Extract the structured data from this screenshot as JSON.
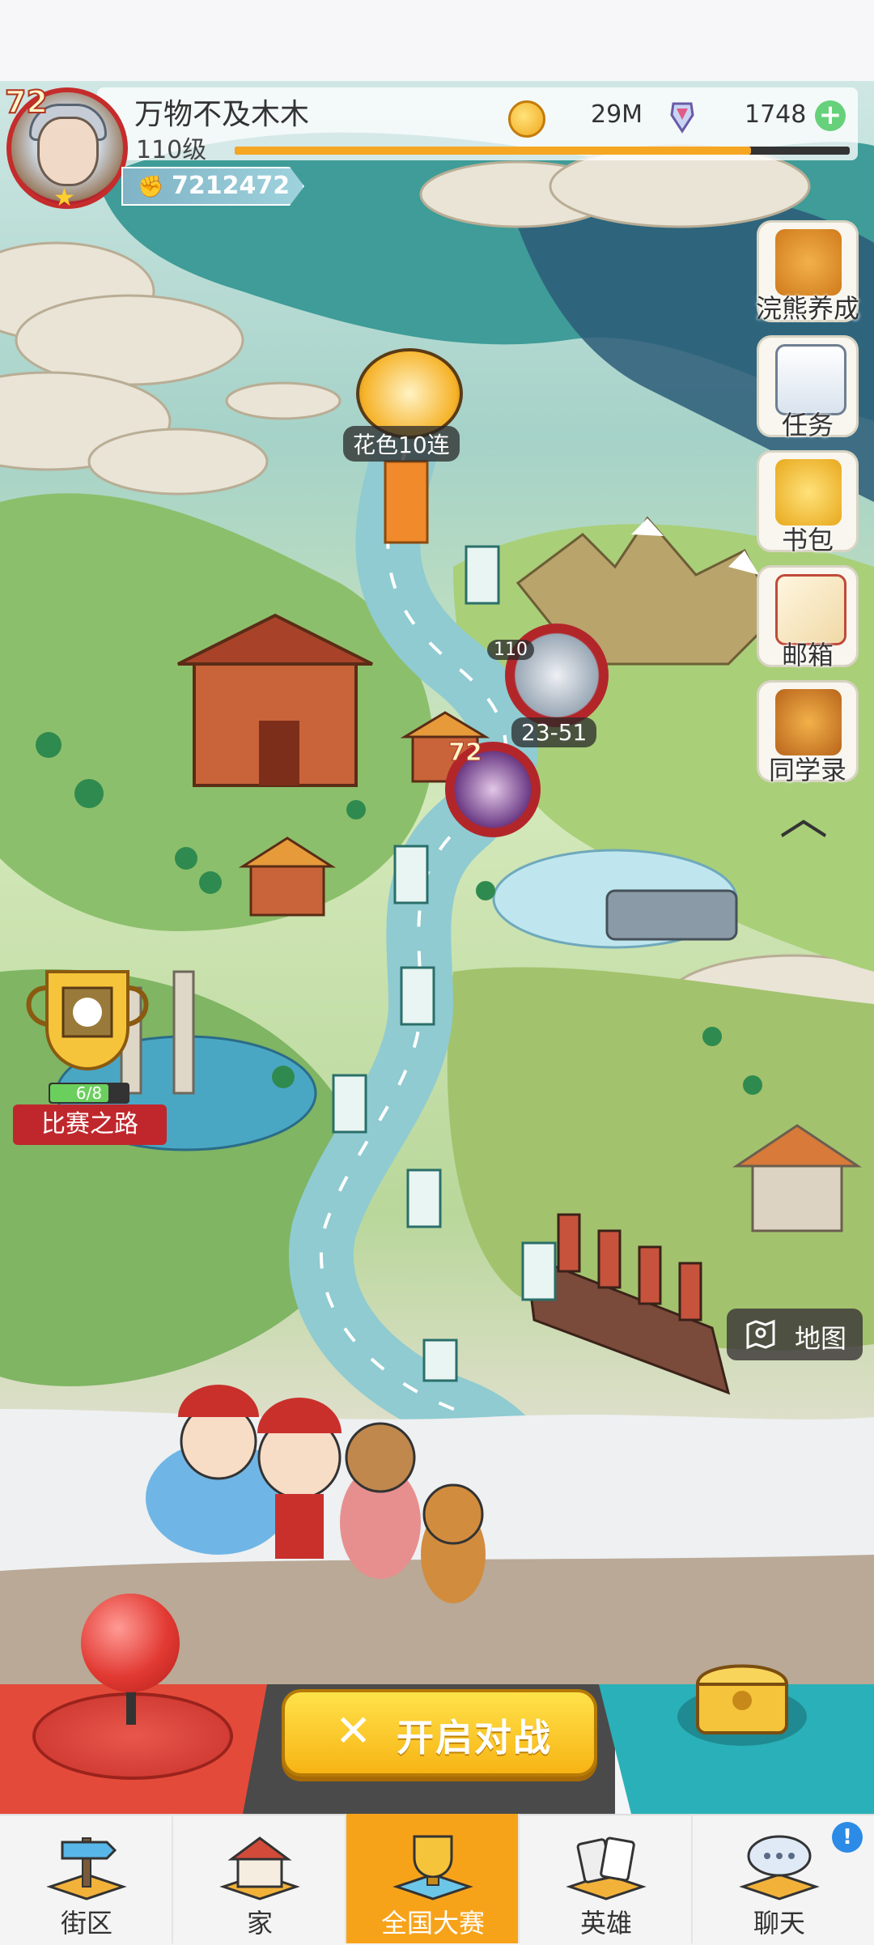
{
  "player": {
    "name": "万物不及木木",
    "level_label": "110级",
    "avatar_level": "72",
    "power": "7212472",
    "xp_fraction": 0.84
  },
  "currency": {
    "coins": "29M",
    "gems": "1748"
  },
  "side_menu": [
    {
      "label": "浣熊养成",
      "icon": "raccoon-icon"
    },
    {
      "label": "任务",
      "icon": "clipboard-icon"
    },
    {
      "label": "书包",
      "icon": "backpack-icon"
    },
    {
      "label": "邮箱",
      "icon": "mail-icon"
    },
    {
      "label": "同学录",
      "icon": "classmates-icon"
    }
  ],
  "map": {
    "event_label": "花色10连",
    "player_marker_level": "110",
    "stage_label": "23-51",
    "rival_marker_level": "72",
    "race_road_label": "比赛之路",
    "race_progress": "6/8",
    "race_progress_fraction": 0.75,
    "map_button_label": "地图"
  },
  "controls": {
    "fight_label": "开启对战"
  },
  "nav": [
    {
      "label": "街区",
      "icon": "signpost-icon"
    },
    {
      "label": "家",
      "icon": "house-icon"
    },
    {
      "label": "全国大赛",
      "icon": "trophy-icon",
      "active": true
    },
    {
      "label": "英雄",
      "icon": "cards-icon"
    },
    {
      "label": "聊天",
      "icon": "chat-icon"
    }
  ],
  "chat_badge": "!",
  "colors": {
    "active_tab": "#f7a31a",
    "fight_button": "#f7c21c",
    "xp_fill": "#f5a623"
  }
}
